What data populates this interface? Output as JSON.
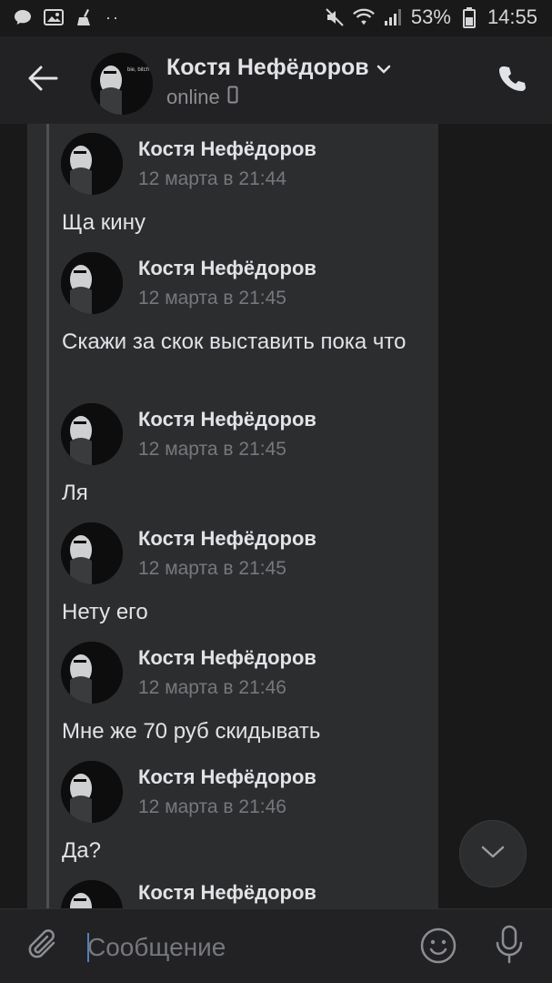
{
  "status_bar": {
    "battery_percent": "53%",
    "time": "14:55",
    "dots": "··"
  },
  "header": {
    "contact_name": "Костя Нефёдоров",
    "status": "online",
    "avatar_text": "bie, bitch"
  },
  "messages": [
    {
      "author": "Костя Нефёдоров",
      "date": "12 марта в 21:44",
      "text": "Ща кину"
    },
    {
      "author": "Костя Нефёдоров",
      "date": "12 марта в 21:45",
      "text": "Скажи за скок выставить пока что"
    },
    {
      "author": "Костя Нефёдоров",
      "date": "12 марта в 21:45",
      "text": "Ля"
    },
    {
      "author": "Костя Нефёдоров",
      "date": "12 марта в 21:45",
      "text": "Нету его"
    },
    {
      "author": "Костя Нефёдоров",
      "date": "12 марта в 21:46",
      "text": "Мне же 70 руб скидывать"
    },
    {
      "author": "Костя Нефёдоров",
      "date": "12 марта в 21:46",
      "text": "Да?"
    },
    {
      "author": "Костя Нефёдоров",
      "date": "",
      "text": ""
    }
  ],
  "composer": {
    "placeholder": "Сообщение"
  },
  "colors": {
    "background": "#19191a",
    "header": "#222224",
    "forward_panel": "#2c2d2f",
    "text": "#e1e3e6",
    "muted": "#76787d",
    "accent": "#5181b8"
  },
  "icons": {
    "status_left": [
      "chat-icon",
      "image-icon",
      "cleaner-icon"
    ],
    "status_right": [
      "mute-icon",
      "wifi-icon",
      "signal-icon",
      "battery-icon"
    ],
    "header": [
      "back-arrow-icon",
      "chevron-down-icon",
      "phone-device-icon",
      "call-icon"
    ],
    "composer": [
      "paperclip-icon",
      "emoji-icon",
      "microphone-icon"
    ],
    "scroll": "chevron-down-icon"
  }
}
